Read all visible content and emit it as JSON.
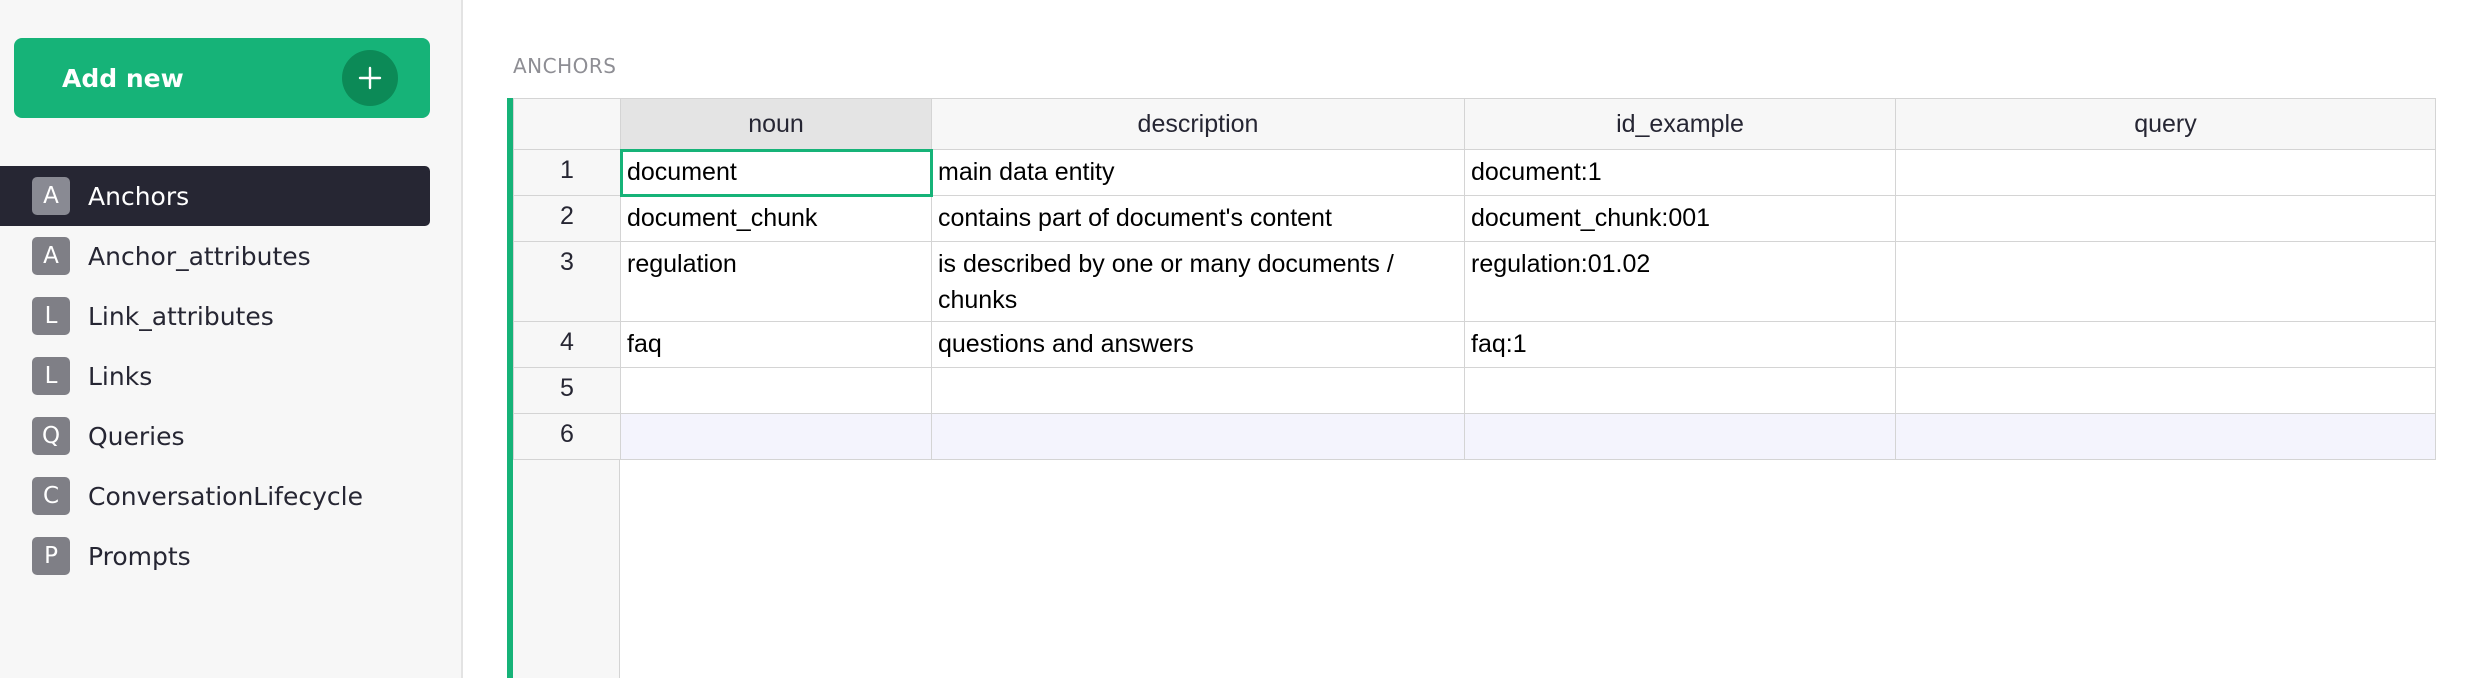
{
  "sidebar": {
    "add_new_label": "Add new",
    "pages": [
      {
        "initial": "A",
        "label": "Anchors"
      },
      {
        "initial": "A",
        "label": "Anchor_attributes"
      },
      {
        "initial": "L",
        "label": "Link_attributes"
      },
      {
        "initial": "L",
        "label": "Links"
      },
      {
        "initial": "Q",
        "label": "Queries"
      },
      {
        "initial": "C",
        "label": "ConversationLifecycle"
      },
      {
        "initial": "P",
        "label": "Prompts"
      }
    ],
    "active_page": "Anchors"
  },
  "main": {
    "section_title": "ANCHORS",
    "add_column_label": "+",
    "columns": [
      "noun",
      "description",
      "id_example",
      "query"
    ],
    "rows": [
      {
        "num": "1",
        "cells": [
          "document",
          "main data entity",
          "document:1",
          ""
        ]
      },
      {
        "num": "2",
        "cells": [
          "document_chunk",
          "contains part of document's content",
          "document_chunk:001",
          ""
        ]
      },
      {
        "num": "3",
        "cells": [
          "regulation",
          "is described by one or many documents / chunks",
          "regulation:01.02",
          ""
        ]
      },
      {
        "num": "4",
        "cells": [
          "faq",
          "questions and answers",
          "faq:1",
          ""
        ]
      },
      {
        "num": "5",
        "cells": [
          "",
          "",
          "",
          ""
        ]
      },
      {
        "num": "6",
        "cells": [
          "",
          "",
          "",
          ""
        ]
      }
    ]
  },
  "colors": {
    "accent": "#16b378",
    "active_page_bg": "#262633",
    "new_row_bg": "#f4f4fd"
  },
  "icons": {
    "add_new": "plus-icon"
  }
}
